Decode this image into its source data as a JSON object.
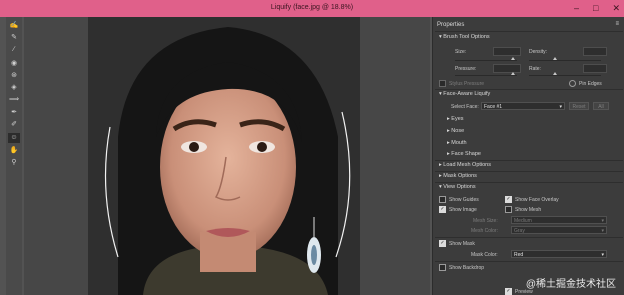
{
  "window": {
    "title": "Liquify (face.jpg @ 18.8%)",
    "minimize": "–",
    "maximize": "□",
    "close": "✕"
  },
  "panel": {
    "title": "Properties",
    "brush": {
      "header": "Brush Tool Options",
      "size": "Size:",
      "density": "Density:",
      "pressure": "Pressure:",
      "rate": "Rate:",
      "stylus": "Stylus Pressure",
      "pin_edges": "Pin Edges"
    },
    "face": {
      "header": "Face-Aware Liquify",
      "select_face_label": "Select Face:",
      "select_face_value": "Face #1",
      "reset": "Reset",
      "all": "All",
      "items": [
        "Eyes",
        "Nose",
        "Mouth",
        "Face Shape"
      ]
    },
    "load_mesh": "Load Mesh Options",
    "mask_options": "Mask Options",
    "view": {
      "header": "View Options",
      "show_guides": "Show Guides",
      "show_face_overlay": "Show Face Overlay",
      "show_image": "Show Image",
      "show_mesh": "Show Mesh",
      "mesh_size_label": "Mesh Size:",
      "mesh_size_value": "Medium",
      "mesh_color_label": "Mesh Color:",
      "mesh_color_value": "Gray",
      "show_mask": "Show Mask",
      "mask_color_label": "Mask Color:",
      "mask_color_value": "Red",
      "show_backdrop": "Show Backdrop"
    },
    "preview": "Preview"
  },
  "watermark": "@稀土掘金技术社区",
  "icons": [
    "forward-warp-icon",
    "reconstruct-icon",
    "smooth-icon",
    "twirl-icon",
    "pucker-icon",
    "bloat-icon",
    "push-left-icon",
    "freeze-mask-icon",
    "thaw-mask-icon",
    "face-tool-icon",
    "hand-icon",
    "zoom-icon"
  ],
  "colors": {
    "titlebar": "#e0608a",
    "panel": "#3c3c3c",
    "canvas": "#474747"
  }
}
